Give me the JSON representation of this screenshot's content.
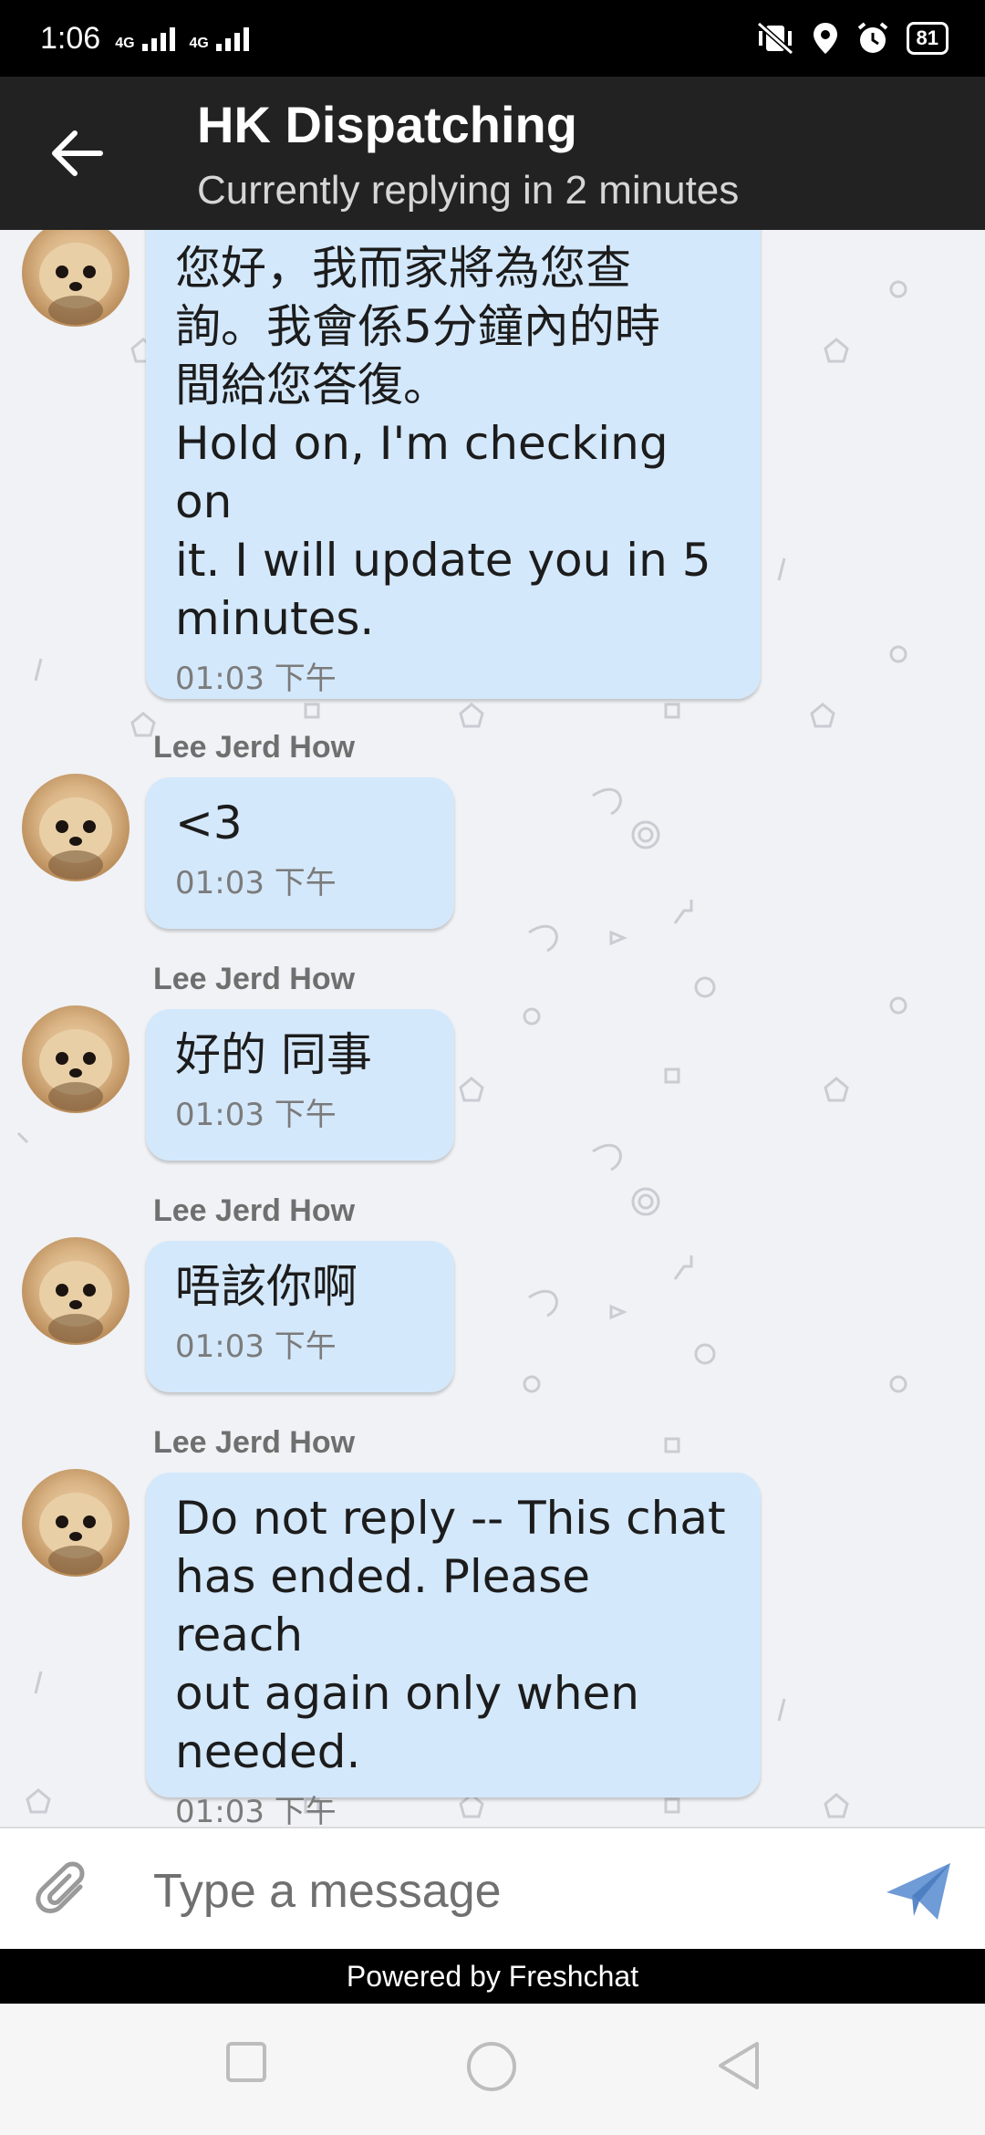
{
  "status_bar": {
    "time": "1:06",
    "network_1": "4G",
    "network_2": "4G",
    "battery": "81"
  },
  "header": {
    "title": "HK Dispatching",
    "subtitle": "Currently replying in 2 minutes"
  },
  "messages": [
    {
      "sender": "",
      "text": "您好，我而家將為您查\n詢。我會係5分鐘內的時\n間給您答復。\nHold on, I'm checking on\nit. I will update you in 5\nminutes.",
      "time": "01:03 下午"
    },
    {
      "sender": "Lee Jerd How",
      "text": "<3",
      "time": "01:03 下午"
    },
    {
      "sender": "Lee Jerd How",
      "text": "好的 同事",
      "time": "01:03 下午"
    },
    {
      "sender": "Lee Jerd How",
      "text": "唔該你啊",
      "time": "01:03 下午"
    },
    {
      "sender": "Lee Jerd How",
      "text": "Do not reply -- This chat\nhas ended. Please reach\nout again only when\nneeded.",
      "time": "01:03 下午"
    }
  ],
  "composer": {
    "placeholder": "Type a message"
  },
  "footer": {
    "powered_by": "Powered by Freshchat"
  },
  "colors": {
    "header_bg": "#222222",
    "bubble_bg": "#d4e8fb",
    "chat_bg": "#f0f2f5",
    "send_icon": "#6f9bd6"
  }
}
